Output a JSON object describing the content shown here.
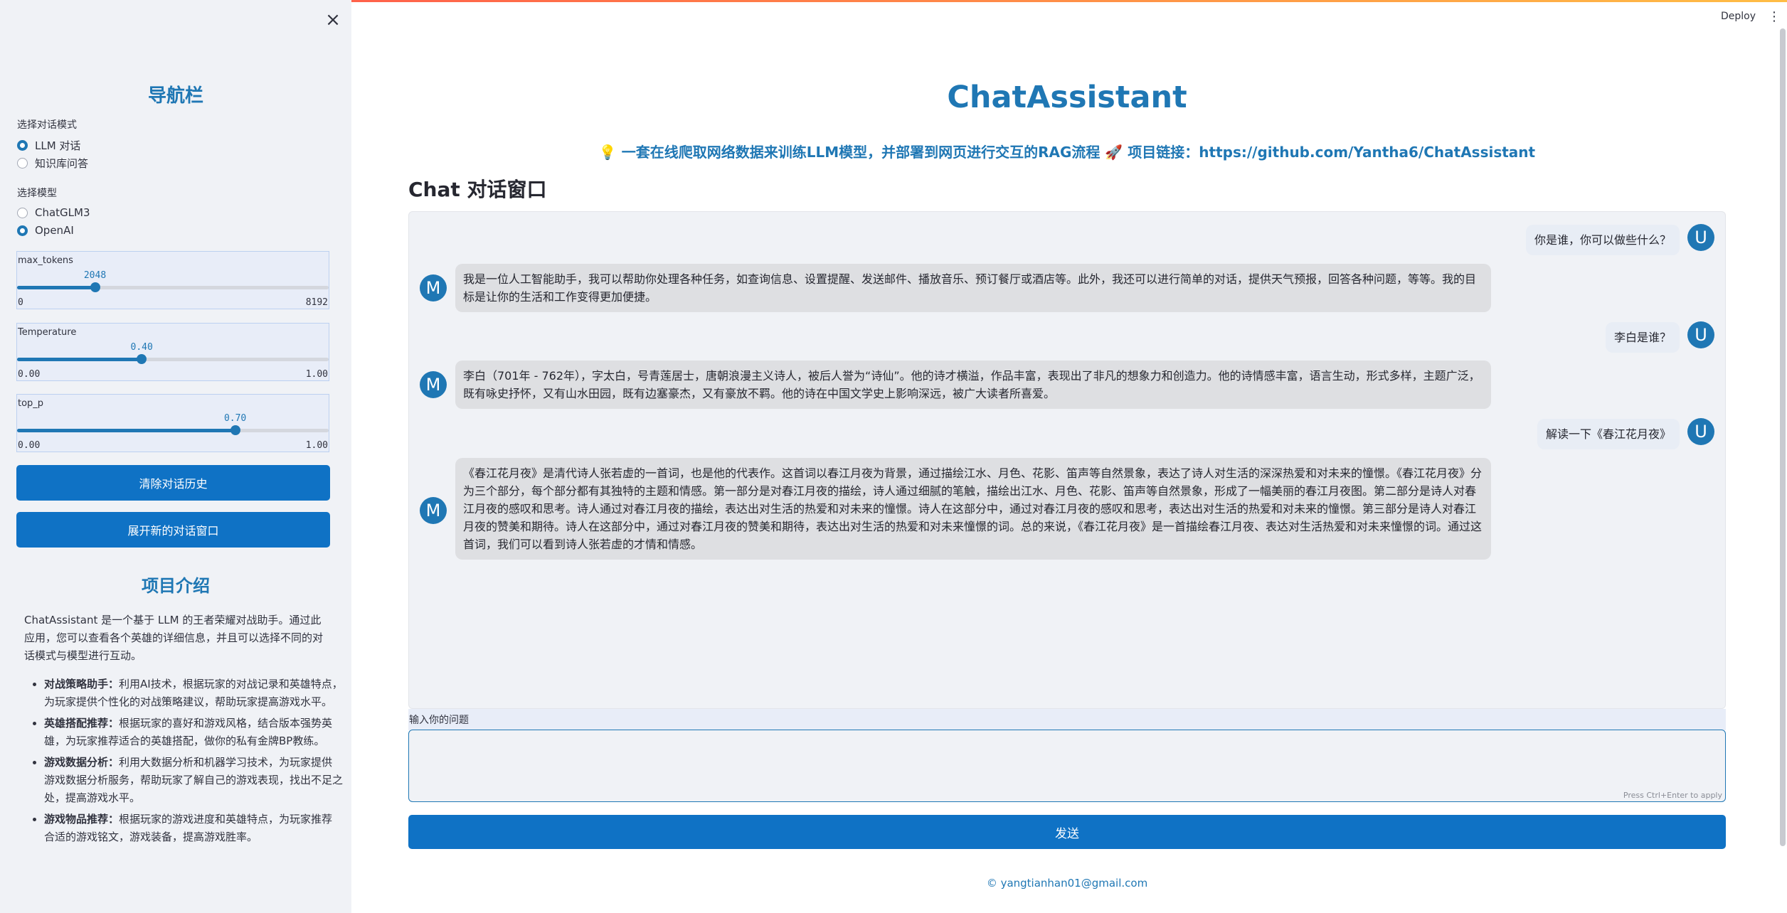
{
  "sidebar": {
    "close_icon": "×",
    "nav_title": "导航栏",
    "mode_label": "选择对话模式",
    "modes": [
      {
        "label": "LLM 对话",
        "selected": true
      },
      {
        "label": "知识库问答",
        "selected": false
      }
    ],
    "model_label": "选择模型",
    "models": [
      {
        "label": "ChatGLM3",
        "selected": false
      },
      {
        "label": "OpenAI",
        "selected": true
      }
    ],
    "sliders": [
      {
        "label": "max_tokens",
        "value": "2048",
        "min": "0",
        "max": "8192",
        "fraction": 0.25
      },
      {
        "label": "Temperature",
        "value": "0.40",
        "min": "0.00",
        "max": "1.00",
        "fraction": 0.4
      },
      {
        "label": "top_p",
        "value": "0.70",
        "min": "0.00",
        "max": "1.00",
        "fraction": 0.7
      }
    ],
    "clear_button": "清除对话历史",
    "new_window_button": "展开新的对话窗口",
    "intro_title": "项目介绍",
    "intro_text": "ChatAssistant 是一个基于 LLM 的王者荣耀对战助手。通过此应用，您可以查看各个英雄的详细信息，并且可以选择不同的对话模式与模型进行互动。",
    "features": [
      {
        "title": "对战策略助手：",
        "text": "利用AI技术，根据玩家的对战记录和英雄特点，为玩家提供个性化的对战策略建议，帮助玩家提高游戏水平。"
      },
      {
        "title": "英雄搭配推荐：",
        "text": "根据玩家的喜好和游戏风格，结合版本强势英雄，为玩家推荐适合的英雄搭配，做你的私有金牌BP教练。"
      },
      {
        "title": "游戏数据分析：",
        "text": "利用大数据分析和机器学习技术，为玩家提供游戏数据分析服务，帮助玩家了解自己的游戏表现，找出不足之处，提高游戏水平。"
      },
      {
        "title": "游戏物品推荐：",
        "text": "根据玩家的游戏进度和英雄特点，为玩家推荐合适的游戏铭文，游戏装备，提高游戏胜率。"
      }
    ]
  },
  "header": {
    "deploy": "Deploy",
    "menu_icon": "⋮"
  },
  "main": {
    "title": "ChatAssistant",
    "subtitle_icon": "💡",
    "subtitle": "一套在线爬取网络数据来训练LLM模型，并部署到网页进行交互的RAG流程",
    "rocket_icon": "🚀",
    "link_label": "项目链接：",
    "link_url": "https://github.com/Yantha6/ChatAssistant",
    "chat_header": "Chat 对话窗口",
    "messages": [
      {
        "role": "user",
        "avatar": "U",
        "text": "你是谁，你可以做些什么？"
      },
      {
        "role": "bot",
        "avatar": "M",
        "text": "我是一位人工智能助手，我可以帮助你处理各种任务，如查询信息、设置提醒、发送邮件、播放音乐、预订餐厅或酒店等。此外，我还可以进行简单的对话，提供天气预报，回答各种问题，等等。我的目标是让你的生活和工作变得更加便捷。"
      },
      {
        "role": "user",
        "avatar": "U",
        "text": "李白是谁？"
      },
      {
        "role": "bot",
        "avatar": "M",
        "text": "李白（701年 - 762年），字太白，号青莲居士，唐朝浪漫主义诗人，被后人誉为“诗仙”。他的诗才横溢，作品丰富，表现出了非凡的想象力和创造力。他的诗情感丰富，语言生动，形式多样，主题广泛，既有咏史抒怀，又有山水田园，既有边塞豪杰，又有豪放不羁。他的诗在中国文学史上影响深远，被广大读者所喜爱。"
      },
      {
        "role": "user",
        "avatar": "U",
        "text": "解读一下《春江花月夜》"
      },
      {
        "role": "bot",
        "avatar": "M",
        "text": "《春江花月夜》是清代诗人张若虚的一首词，也是他的代表作。这首词以春江月夜为背景，通过描绘江水、月色、花影、笛声等自然景象，表达了诗人对生活的深深热爱和对未来的憧憬。《春江花月夜》分为三个部分，每个部分都有其独特的主题和情感。第一部分是对春江月夜的描绘，诗人通过细腻的笔触，描绘出江水、月色、花影、笛声等自然景象，形成了一幅美丽的春江月夜图。第二部分是诗人对春江月夜的感叹和思考。诗人通过对春江月夜的描绘，表达出对生活的热爱和对未来的憧憬。诗人在这部分中，通过对春江月夜的感叹和思考，表达出对生活的热爱和对未来的憧憬。第三部分是诗人对春江月夜的赞美和期待。诗人在这部分中，通过对春江月夜的赞美和期待，表达出对生活的热爱和对未来憧憬的词。总的来说，《春江花月夜》是一首描绘春江月夜、表达对生活热爱和对未来憧憬的词。通过这首词，我们可以看到诗人张若虚的才情和情感。"
      }
    ],
    "input_label": "输入你的问题",
    "input_value": "",
    "input_hint": "Press Ctrl+Enter to apply",
    "send_button": "发送",
    "footer": "© yangtianhan01@gmail.com"
  }
}
